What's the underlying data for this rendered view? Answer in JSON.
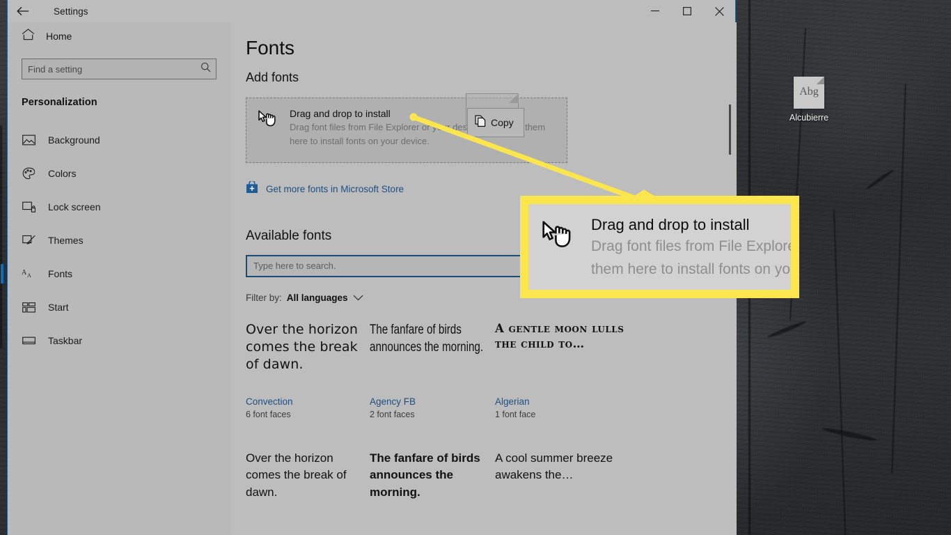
{
  "desktop": {
    "icon": {
      "label": "Alcubierre",
      "thumb_text": "Abg",
      "icon_name": "font-file-icon"
    }
  },
  "window": {
    "title": "Settings",
    "back_icon": "back-arrow-icon",
    "controls": {
      "minimize": "minimize-icon",
      "maximize": "maximize-icon",
      "close": "close-icon"
    }
  },
  "sidebar": {
    "home": {
      "label": "Home",
      "icon": "home-icon"
    },
    "search": {
      "placeholder": "Find a setting",
      "icon": "search-icon"
    },
    "category": "Personalization",
    "items": [
      {
        "label": "Background",
        "icon": "image-icon",
        "active": false
      },
      {
        "label": "Colors",
        "icon": "palette-icon",
        "active": false
      },
      {
        "label": "Lock screen",
        "icon": "lock-screen-icon",
        "active": false
      },
      {
        "label": "Themes",
        "icon": "themes-brush-icon",
        "active": false
      },
      {
        "label": "Fonts",
        "icon": "font-aa-icon",
        "active": true
      },
      {
        "label": "Start",
        "icon": "start-tiles-icon",
        "active": false
      },
      {
        "label": "Taskbar",
        "icon": "taskbar-icon",
        "active": false
      }
    ]
  },
  "main": {
    "page_title": "Fonts",
    "add_fonts_heading": "Add fonts",
    "dropzone": {
      "icon": "drag-hand-cursor-icon",
      "title": "Drag and drop to install",
      "subtitle": "Drag font files from File Explorer or your desktop and drop them here to install fonts on your device."
    },
    "store_link": {
      "label": "Get more fonts in Microsoft Store",
      "icon": "microsoft-store-icon"
    },
    "available_heading": "Available fonts",
    "font_search_placeholder": "Type here to search.",
    "filter": {
      "label": "Filter by:",
      "value": "All languages",
      "icon": "chevron-down-icon"
    },
    "font_rows": [
      [
        {
          "preview": "Over the horizon comes the break of dawn.",
          "name": "Convection",
          "faces": "6 font faces",
          "style": "f-convection"
        },
        {
          "preview": "The fanfare of birds announces the morning.",
          "name": "Agency FB",
          "faces": "2 font faces",
          "style": "f-agency"
        },
        {
          "preview": "A gentle moon lulls the child to…",
          "name": "Algerian",
          "faces": "1 font face",
          "style": "f-algerian"
        }
      ],
      [
        {
          "preview": "Over the horizon comes the break of dawn.",
          "name": "",
          "faces": "",
          "style": "f-sans"
        },
        {
          "preview": "The fanfare of birds announces the morning.",
          "name": "",
          "faces": "",
          "style": "f-bold"
        },
        {
          "preview": "A cool summer breeze awakens the…",
          "name": "",
          "faces": "",
          "style": "f-sans"
        }
      ]
    ]
  },
  "drag_operation": {
    "tooltip_label": "Copy",
    "tooltip_icon": "copy-pages-icon",
    "ghost_name": "dragged-font-file-ghost"
  },
  "callout": {
    "title": "Drag and drop to install",
    "subtitle_line1": "Drag font files from File Explore",
    "subtitle_line2": "them here to install fonts on yo",
    "icon": "drag-hand-cursor-icon",
    "accent_color": "#fbe64d"
  }
}
